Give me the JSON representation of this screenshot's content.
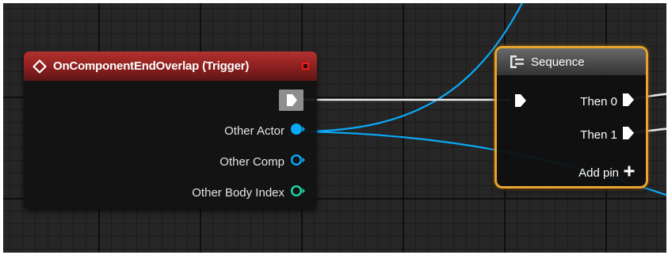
{
  "event_node": {
    "title": "OnComponentEndOverlap (Trigger)",
    "header_color": "#a22622",
    "pins": [
      {
        "label": "Other Actor",
        "type": "object",
        "connected": true,
        "color": "#0aa9f5"
      },
      {
        "label": "Other Comp",
        "type": "component",
        "connected": false,
        "color": "#0aa9f5"
      },
      {
        "label": "Other Body Index",
        "type": "integer",
        "connected": false,
        "color": "#1ed6a5"
      }
    ]
  },
  "sequence_node": {
    "title": "Sequence",
    "outputs": [
      "Then 0",
      "Then 1"
    ],
    "add_pin_label": "Add pin",
    "selected": true,
    "highlight_color": "#e9a42d"
  },
  "colors": {
    "exec_wire": "#e8e8e8",
    "object_wire": "#0aa9f5",
    "grid_bg": "#262626"
  }
}
